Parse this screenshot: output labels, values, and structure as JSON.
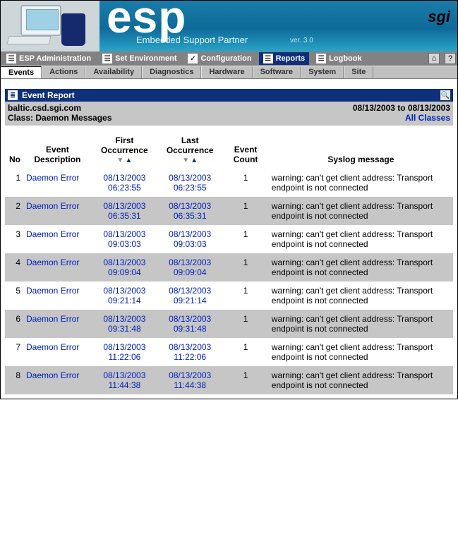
{
  "banner": {
    "product": "esp",
    "subtitle": "Embedded Support Partner",
    "version": "ver. 3.0",
    "brand": "sgi"
  },
  "menu": {
    "items": [
      {
        "label": "ESP Administration",
        "icon": "☰"
      },
      {
        "label": "Set Environment",
        "icon": "☰"
      },
      {
        "label": "Configuration",
        "icon": "✓"
      },
      {
        "label": "Reports",
        "icon": "☰",
        "active": true
      },
      {
        "label": "Logbook",
        "icon": "☰"
      }
    ],
    "home_icon": "⌂",
    "help_icon": "?"
  },
  "tabs": [
    {
      "label": "Events",
      "active": true
    },
    {
      "label": "Actions"
    },
    {
      "label": "Availability"
    },
    {
      "label": "Diagnostics"
    },
    {
      "label": "Hardware"
    },
    {
      "label": "Software"
    },
    {
      "label": "System"
    },
    {
      "label": "Site"
    }
  ],
  "report": {
    "title": "Event Report",
    "host": "baltic.csd.sgi.com",
    "daterange": "08/13/2003 to 08/13/2003",
    "class_label": "Class: Daemon Messages",
    "all_classes": "All Classes"
  },
  "columns": {
    "no": "No",
    "desc": "Event Description",
    "first": "First Occurrence",
    "last": "Last Occurrence",
    "count": "Event Count",
    "msg": "Syslog message"
  },
  "rows": [
    {
      "no": "1",
      "desc": "Daemon Error",
      "first_date": "08/13/2003",
      "first_time": "06:23:55",
      "last_date": "08/13/2003",
      "last_time": "06:23:55",
      "count": "1",
      "msg": "warning: can't get client address: Transport endpoint is not connected"
    },
    {
      "no": "2",
      "desc": "Daemon Error",
      "first_date": "08/13/2003",
      "first_time": "06:35:31",
      "last_date": "08/13/2003",
      "last_time": "06:35:31",
      "count": "1",
      "msg": "warning: can't get client address: Transport endpoint is not connected"
    },
    {
      "no": "3",
      "desc": "Daemon Error",
      "first_date": "08/13/2003",
      "first_time": "09:03:03",
      "last_date": "08/13/2003",
      "last_time": "09:03:03",
      "count": "1",
      "msg": "warning: can't get client address: Transport endpoint is not connected"
    },
    {
      "no": "4",
      "desc": "Daemon Error",
      "first_date": "08/13/2003",
      "first_time": "09:09:04",
      "last_date": "08/13/2003",
      "last_time": "09:09:04",
      "count": "1",
      "msg": "warning: can't get client address: Transport endpoint is not connected"
    },
    {
      "no": "5",
      "desc": "Daemon Error",
      "first_date": "08/13/2003",
      "first_time": "09:21:14",
      "last_date": "08/13/2003",
      "last_time": "09:21:14",
      "count": "1",
      "msg": "warning: can't get client address: Transport endpoint is not connected"
    },
    {
      "no": "6",
      "desc": "Daemon Error",
      "first_date": "08/13/2003",
      "first_time": "09:31:48",
      "last_date": "08/13/2003",
      "last_time": "09:31:48",
      "count": "1",
      "msg": "warning: can't get client address: Transport endpoint is not connected"
    },
    {
      "no": "7",
      "desc": "Daemon Error",
      "first_date": "08/13/2003",
      "first_time": "11:22:06",
      "last_date": "08/13/2003",
      "last_time": "11:22:06",
      "count": "1",
      "msg": "warning: can't get client address: Transport endpoint is not connected"
    },
    {
      "no": "8",
      "desc": "Daemon Error",
      "first_date": "08/13/2003",
      "first_time": "11:44:38",
      "last_date": "08/13/2003",
      "last_time": "11:44:38",
      "count": "1",
      "msg": "warning: can't get client address: Transport endpoint is not connected"
    }
  ]
}
